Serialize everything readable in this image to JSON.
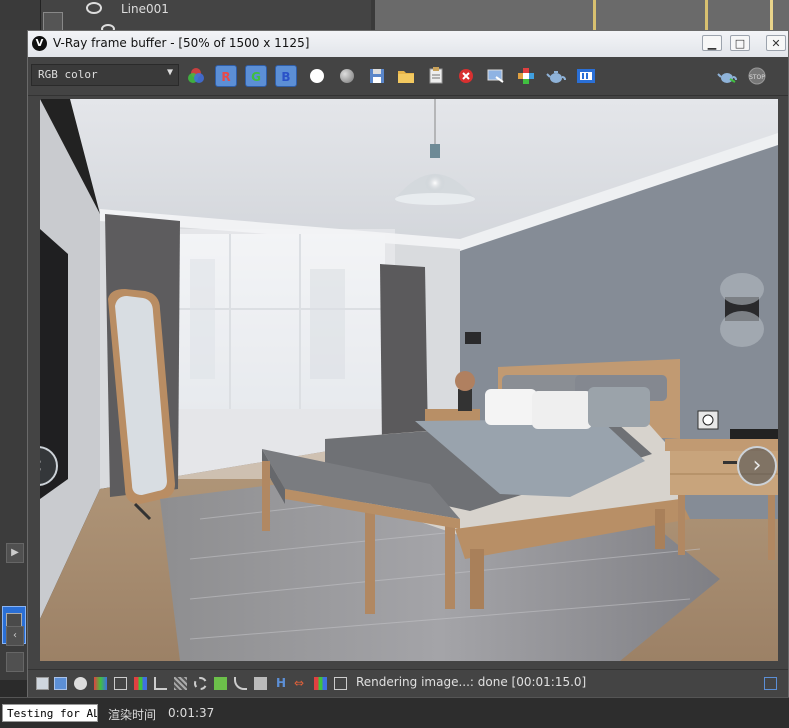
{
  "background": {
    "scene_object": "Line001"
  },
  "window": {
    "title": "V-Ray frame buffer - [50% of 1500 x 1125]",
    "logo": "V"
  },
  "toolbar": {
    "channel": "RGB color",
    "channel_arrow": "▼",
    "r_label": "R",
    "g_label": "G",
    "b_label": "B"
  },
  "status": {
    "text": "Rendering image...: done [00:01:15.0]"
  },
  "bottom": {
    "input_value": "Testing for AL(",
    "render_label": "渲染时间",
    "render_time": "0:01:37"
  },
  "colors": {
    "window_bg": "#444444",
    "channel_button": "#5c8fd6",
    "titlebar": "#e8eaee"
  }
}
